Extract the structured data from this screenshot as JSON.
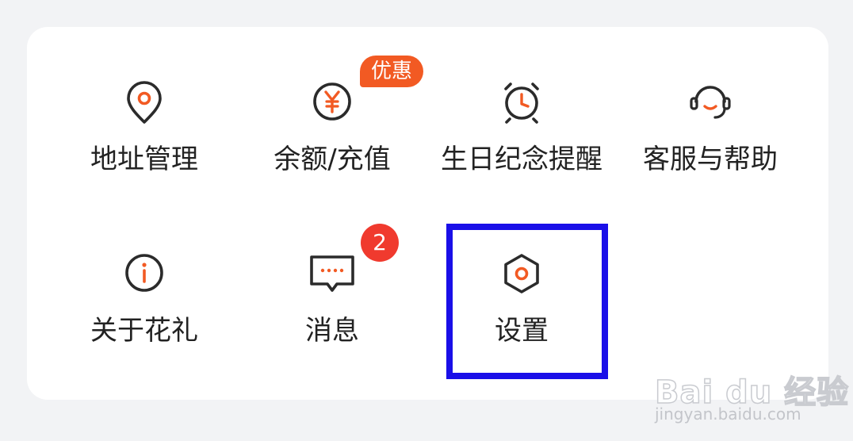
{
  "menu": {
    "row1": [
      {
        "label": "地址管理",
        "icon": "location-pin-icon"
      },
      {
        "label": "余额/充值",
        "icon": "yen-coin-icon"
      },
      {
        "label": "生日纪念提醒",
        "icon": "alarm-clock-icon"
      },
      {
        "label": "客服与帮助",
        "icon": "headset-icon"
      }
    ],
    "row2": [
      {
        "label": "关于花礼",
        "icon": "info-icon"
      },
      {
        "label": "消息",
        "icon": "message-bubble-icon"
      },
      {
        "label": "设置",
        "icon": "hexagon-settings-icon"
      }
    ]
  },
  "badges": {
    "promo": "优惠",
    "message_count": "2"
  },
  "watermark": {
    "logo_text": "Bai du 经验",
    "url": "jingyan.baidu.com"
  },
  "colors": {
    "accent": "#f25a23",
    "icon_stroke": "#2b2b2b",
    "badge_red": "#f03a2e",
    "highlight": "#1a0fe8"
  }
}
